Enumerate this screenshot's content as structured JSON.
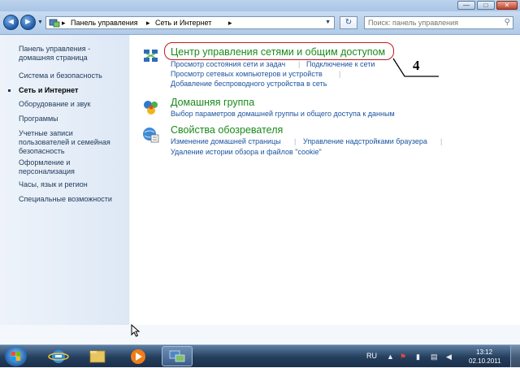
{
  "window": {
    "minimize_glyph": "—",
    "maximize_glyph": "□",
    "close_glyph": "✕"
  },
  "nav": {
    "back_glyph": "◄",
    "forward_glyph": "►",
    "breadcrumb": [
      "Панель управления",
      "Сеть и Интернет"
    ],
    "crumb_sep": "▸",
    "refresh_glyph": "↻",
    "search_placeholder": "Поиск: панель управления",
    "search_glyph": "⚲"
  },
  "sidebar": {
    "items": [
      {
        "label": "Панель управления -\nдомашняя страница"
      },
      {
        "label": "Система и безопасность"
      },
      {
        "label": "Сеть и Интернет",
        "active": true
      },
      {
        "label": "Оборудование и звук"
      },
      {
        "label": "Программы"
      },
      {
        "label": "Учетные записи\nпользователей и семейная\nбезопасность"
      },
      {
        "label": "Оформление и\nперсонализация"
      },
      {
        "label": "Часы, язык и регион"
      },
      {
        "label": "Специальные возможности"
      }
    ]
  },
  "categories": [
    {
      "title": "Центр управления сетями и общим доступом",
      "icon": "network-center-icon",
      "links": [
        "Просмотр состояния сети и задач",
        "Подключение к сети",
        "Просмотр сетевых компьютеров и устройств",
        "Добавление беспроводного устройства в сеть"
      ]
    },
    {
      "title": "Домашняя группа",
      "icon": "homegroup-icon",
      "links": [
        "Выбор параметров домашней группы и общего доступа к данным"
      ]
    },
    {
      "title": "Свойства обозревателя",
      "icon": "internet-options-icon",
      "links": [
        "Изменение домашней страницы",
        "Управление надстройками браузера",
        "Удаление истории обзора и файлов \"cookie\""
      ]
    }
  ],
  "annotation": {
    "number": "4",
    "color": "#c2191b"
  },
  "taskbar": {
    "apps": [
      "start-orb-icon",
      "internet-explorer-icon",
      "explorer-folder-icon",
      "media-player-icon",
      "control-panel-icon"
    ],
    "language": "RU",
    "time": "13:12",
    "date": "02.10.2011"
  },
  "colors": {
    "category_title": "#1a8a1a",
    "link": "#1c54a0",
    "sidebar_text": "#1e395b"
  }
}
